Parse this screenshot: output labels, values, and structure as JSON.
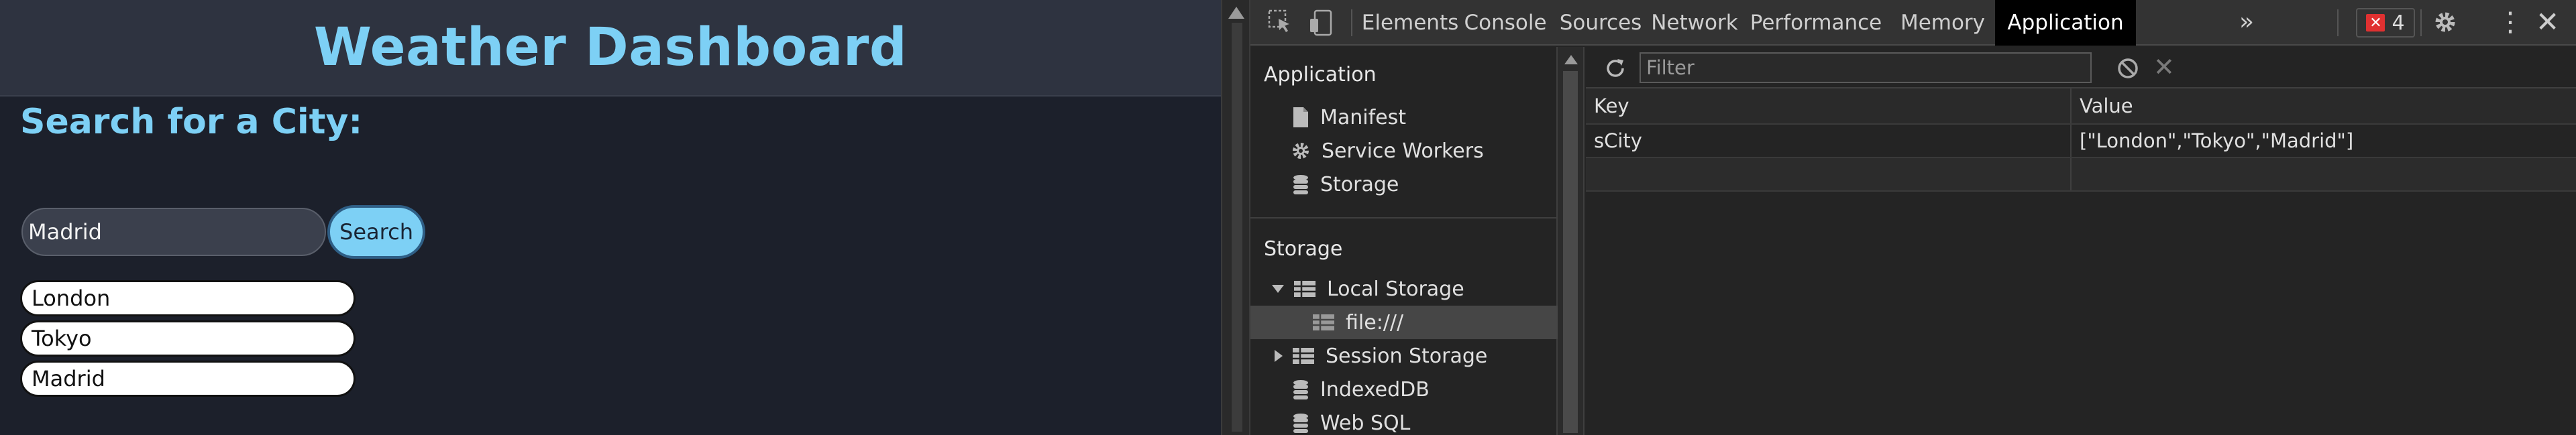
{
  "app": {
    "title": "Weather Dashboard",
    "search_heading": "Search for a City:",
    "search_value": "Madrid",
    "search_button": "Search",
    "cities": [
      "London",
      "Tokyo",
      "Madrid"
    ]
  },
  "devtools": {
    "tabs": [
      "Elements",
      "Console",
      "Sources",
      "Network",
      "Performance",
      "Memory",
      "Application"
    ],
    "active_tab": "Application",
    "more_tabs": "»",
    "error_count": "4",
    "sidebar": {
      "application_title": "Application",
      "application_items": [
        "Manifest",
        "Service Workers",
        "Storage"
      ],
      "storage_title": "Storage",
      "local_storage": "Local Storage",
      "local_storage_child": "file:///",
      "session_storage": "Session Storage",
      "indexeddb": "IndexedDB",
      "websql": "Web SQL"
    },
    "filter_placeholder": "Filter",
    "table": {
      "headers": [
        "Key",
        "Value"
      ],
      "rows": [
        {
          "key": "sCity",
          "value": "[\"London\",\"Tokyo\",\"Madrid\"]"
        }
      ]
    }
  },
  "colors": {
    "app_accent": "#7dd0f5",
    "app_background": "#1c202b",
    "devtools_background": "#242424",
    "error_badge": "#e03131"
  }
}
